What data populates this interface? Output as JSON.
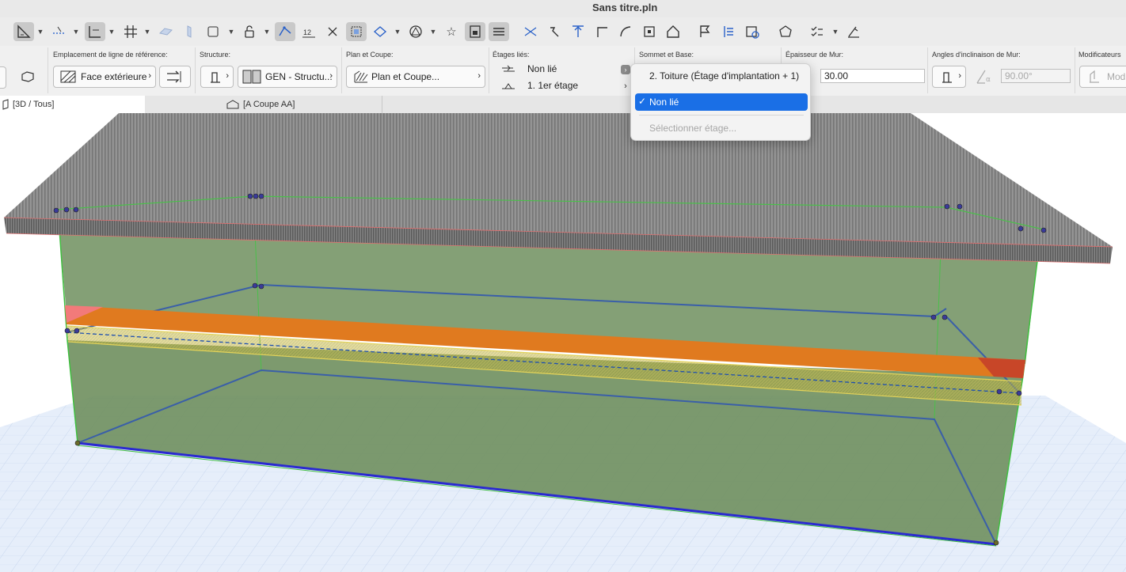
{
  "window": {
    "title": "Sans titre.pln"
  },
  "toolbar": {
    "icons": [
      "ruler-icon",
      "guideline-icon",
      "snap-icon",
      "grid-icon",
      "plane-icon",
      "slab-icon",
      "selection-icon",
      "lock-icon",
      "trace-icon",
      "dimension-icon",
      "cross-icon",
      "group-icon",
      "view-icon",
      "shape-icon",
      "star-icon",
      "layer-icon",
      "stack-icon",
      "scissors-icon",
      "hammer-icon",
      "elevate-icon",
      "corner-icon",
      "curve-icon",
      "crop-icon",
      "house-icon",
      "flag-icon",
      "list-icon",
      "calendar-icon",
      "badge-icon",
      "check-list-icon",
      "brush-icon"
    ]
  },
  "infobox": {
    "reference_line": {
      "label": "Emplacement de ligne de référence:",
      "value": "Face extérieure"
    },
    "structure": {
      "label": "Structure:",
      "value": "GEN - Structu..."
    },
    "plan_section": {
      "label": "Plan et Coupe:",
      "value": "Plan et Coupe..."
    },
    "linked_stories": {
      "label": "Étages liés:",
      "top_value": "Non lié",
      "bottom_value": "1. 1er étage"
    },
    "top_base": {
      "label": "Sommet et Base:"
    },
    "wall_thickness": {
      "label": "Épaisseur de Mur:",
      "value": "30.00"
    },
    "wall_slant": {
      "label": "Angles d'inclinaison de Mur:",
      "value": "90.00°"
    },
    "modifiers": {
      "label": "Modificateurs",
      "value": "Modifi"
    }
  },
  "tabs": [
    {
      "label": "[3D / Tous]"
    },
    {
      "label": "[A Coupe AA]"
    }
  ],
  "dropdown": {
    "items": [
      {
        "label": "2. Toiture (Étage d'implantation + 1)",
        "selected": false,
        "enabled": true
      },
      {
        "label": "Non lié",
        "selected": true,
        "enabled": true
      },
      {
        "label": "Sélectionner étage...",
        "selected": false,
        "enabled": false
      }
    ]
  },
  "colors": {
    "accent": "#1a6fe6",
    "wall_green": "#6f8f5e",
    "roof_gray": "#8a8a8a",
    "slab_orange": "#e07a1f",
    "ground_grid": "#dde8f7"
  }
}
